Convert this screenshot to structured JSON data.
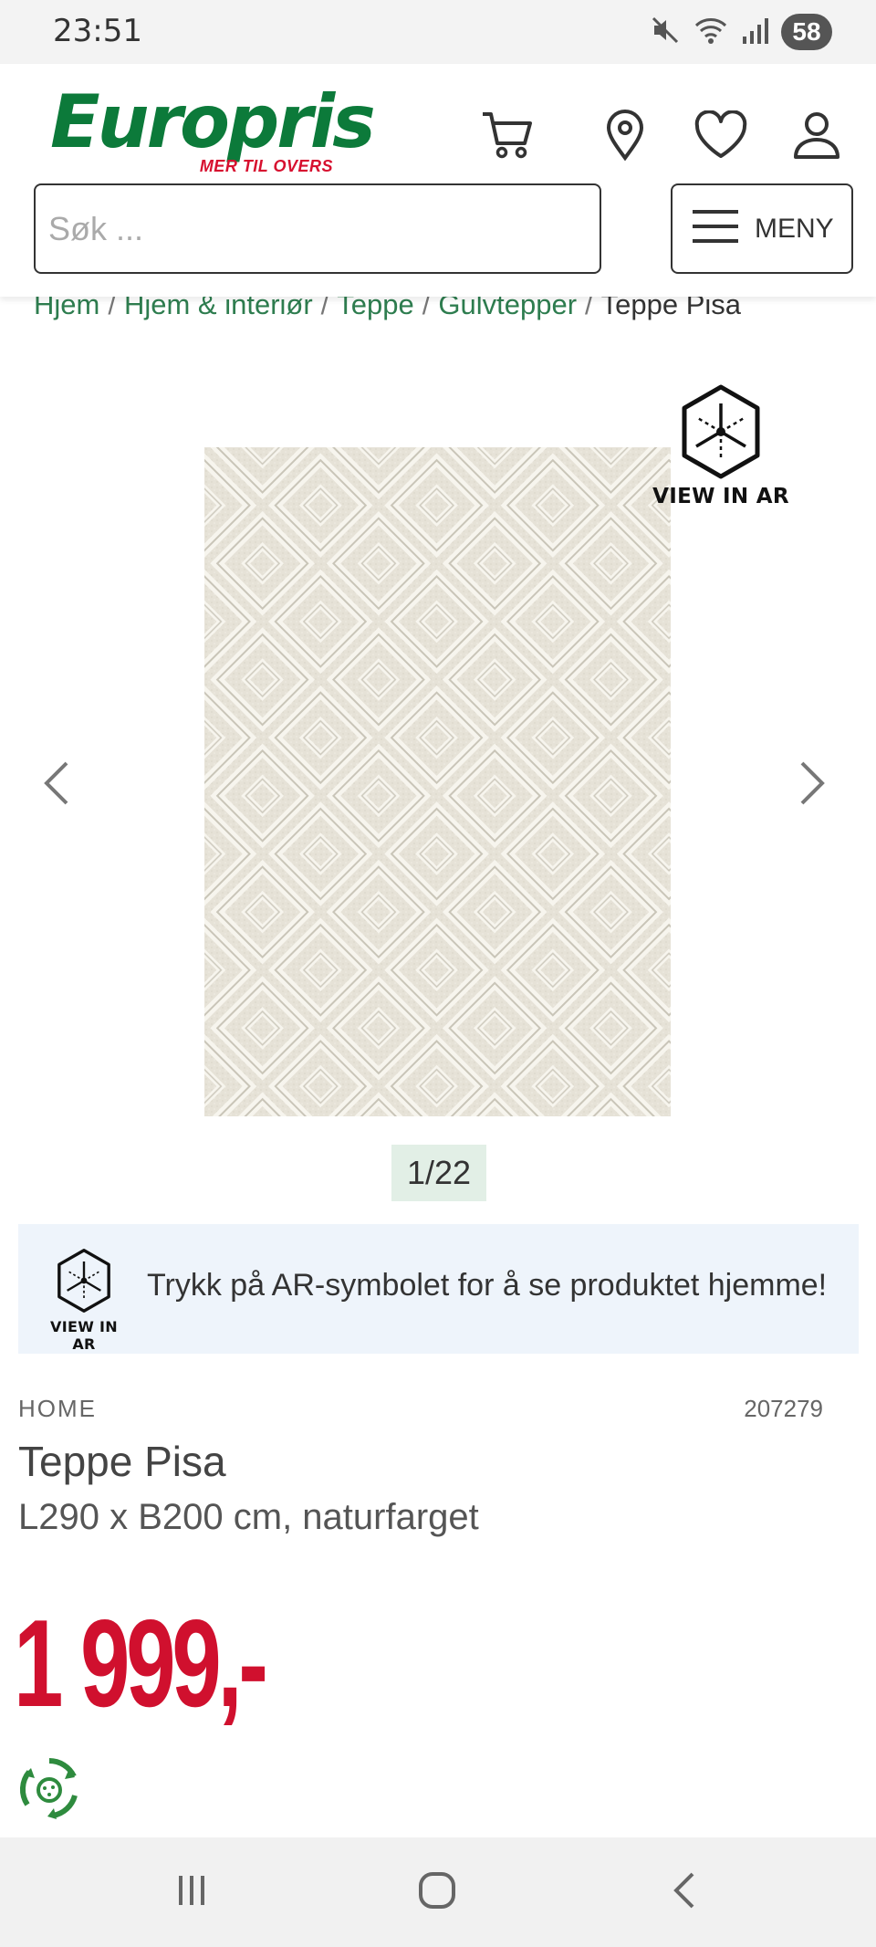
{
  "status_bar": {
    "time": "23:51",
    "battery": "58"
  },
  "header": {
    "logo_text": "Europris",
    "logo_tagline": "MER TIL OVERS",
    "search_placeholder": "Søk ...",
    "menu_label": "MENY"
  },
  "breadcrumb": {
    "items": [
      "Hjem",
      "Hjem & interiør",
      "Teppe",
      "Gulvtepper"
    ],
    "current": "Teppe Pisa",
    "separator": "/"
  },
  "gallery": {
    "view_in_ar_label": "VIEW IN AR",
    "counter": "1/22"
  },
  "ar_banner": {
    "icon_label": "VIEW IN AR",
    "message": "Trykk på AR-symbolet for å se produktet hjemme!"
  },
  "product": {
    "brand": "HOME",
    "sku": "207279",
    "name": "Teppe Pisa",
    "description": "L290 x B200 cm, naturfarget",
    "price": "1 999,-"
  },
  "colors": {
    "brand_green": "#0c7a3a",
    "brand_red": "#d7102f",
    "price_red": "#d0102e",
    "crumb_green": "#2e7d4f",
    "ar_banner_bg": "#eef4fb",
    "counter_bg": "#e2efe6"
  }
}
